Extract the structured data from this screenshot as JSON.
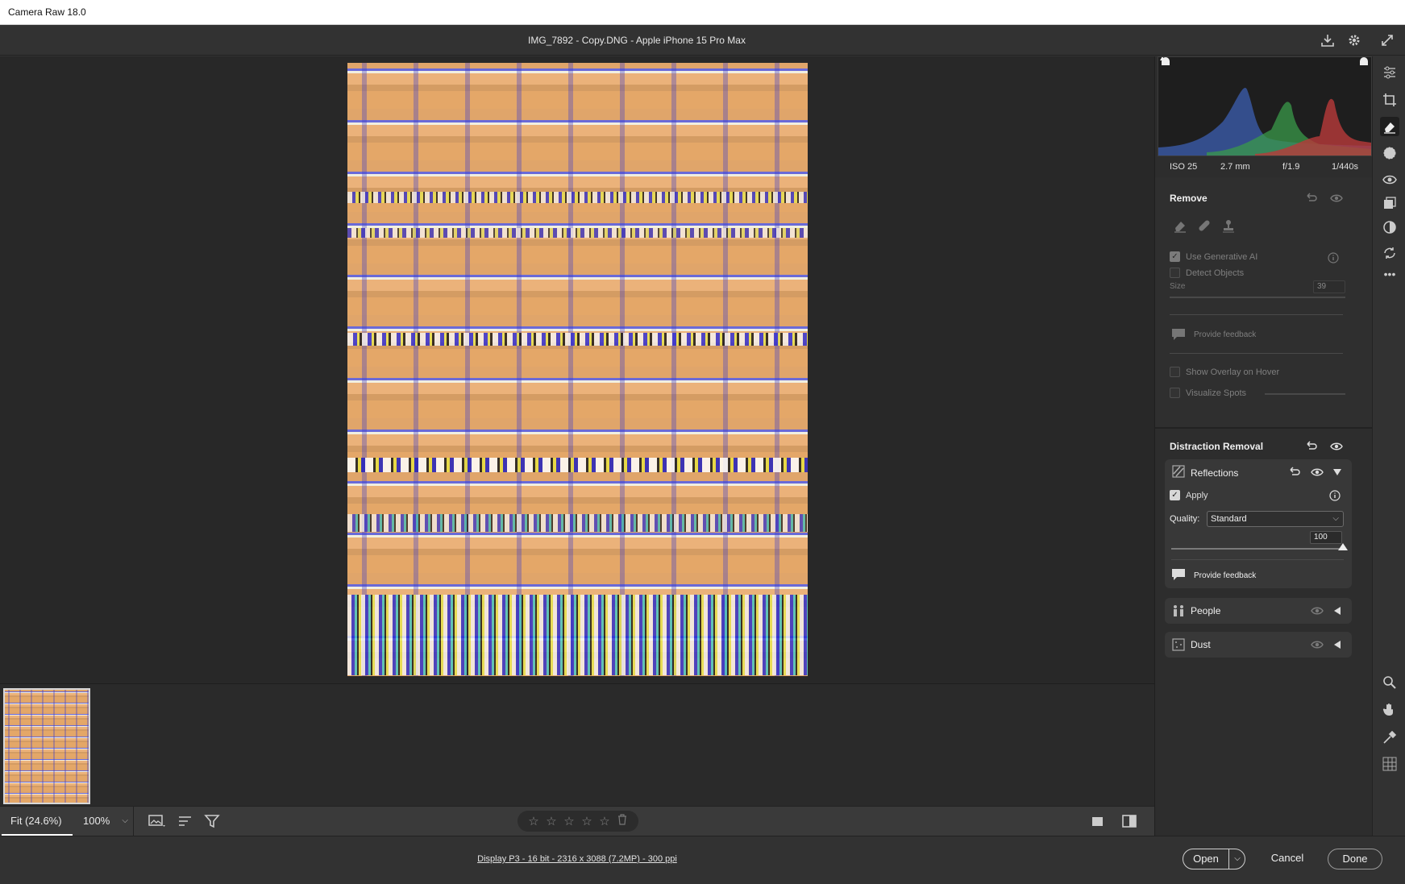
{
  "window": {
    "title": "Camera Raw 18.0"
  },
  "document": {
    "title": "IMG_7892 - Copy.DNG  -  Apple iPhone 15 Pro Max"
  },
  "exif": {
    "iso": "ISO 25",
    "focal": "2.7 mm",
    "aperture": "f/1.9",
    "shutter": "1/440s"
  },
  "remove": {
    "title": "Remove",
    "use_generative_ai": "Use Generative AI",
    "detect_objects": "Detect Objects",
    "size_label": "Size",
    "size_value": "39",
    "provide_feedback": "Provide feedback",
    "show_overlay": "Show Overlay on Hover",
    "visualize_spots": "Visualize Spots"
  },
  "distraction": {
    "title": "Distraction Removal",
    "reflections": {
      "title": "Reflections",
      "apply": "Apply",
      "quality_label": "Quality:",
      "quality_value": "Standard",
      "amount_value": "100",
      "amount": 100,
      "provide_feedback": "Provide feedback"
    },
    "people": {
      "title": "People"
    },
    "dust": {
      "title": "Dust"
    }
  },
  "bottombar": {
    "fit": "Fit (24.6%)",
    "zoom": "100%",
    "stars": [
      "☆",
      "☆",
      "☆",
      "☆",
      "☆"
    ]
  },
  "status": {
    "info": "Display P3 - 16 bit - 2316 x 3088 (7.2MP) - 300 ppi",
    "open": "Open",
    "cancel": "Cancel",
    "done": "Done"
  }
}
